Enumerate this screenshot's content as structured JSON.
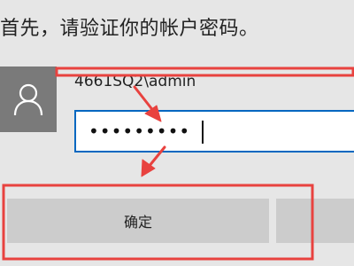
{
  "dialog": {
    "prompt": "首先，请验证你的帐户密码。",
    "account": "4661SQ2\\admin",
    "password_mask": "•••••••••",
    "ok_label": "确定",
    "second_label": ""
  },
  "icons": {
    "avatar": "user-icon"
  },
  "colors": {
    "highlight": "#e8423f",
    "focus_border": "#0067c0",
    "button_bg": "#cccccc",
    "avatar_bg": "#7a7a7a",
    "dialog_bg": "#e6e6e6"
  }
}
